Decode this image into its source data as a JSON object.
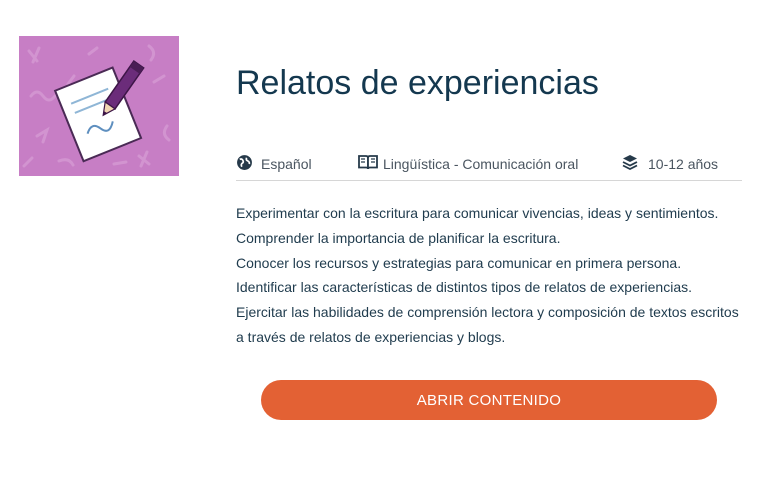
{
  "resource": {
    "title": "Relatos de experiencias",
    "thumbnail_icon": "writing-paper-pencil-icon",
    "thumbnail_color": "#c77ec5"
  },
  "meta": {
    "language": {
      "icon": "globe-icon",
      "label": "Español"
    },
    "subject": {
      "icon": "book-icon",
      "label": "Lingüística - Comunicación oral"
    },
    "age": {
      "icon": "layers-icon",
      "label": "10-12 años"
    }
  },
  "objectives": [
    "Experimentar con la escritura para comunicar vivencias, ideas y sentimientos.",
    "Comprender la importancia de planificar la escritura.",
    "Conocer los recursos y estrategias para comunicar en primera persona.",
    "Identificar las características de distintos tipos de relatos de experiencias.",
    "Ejercitar las habilidades de comprensión lectora y composición de textos escritos",
    "a través de relatos de experiencias y blogs."
  ],
  "actions": {
    "open_label": "ABRIR CONTENIDO",
    "accent_color": "#e36134"
  }
}
